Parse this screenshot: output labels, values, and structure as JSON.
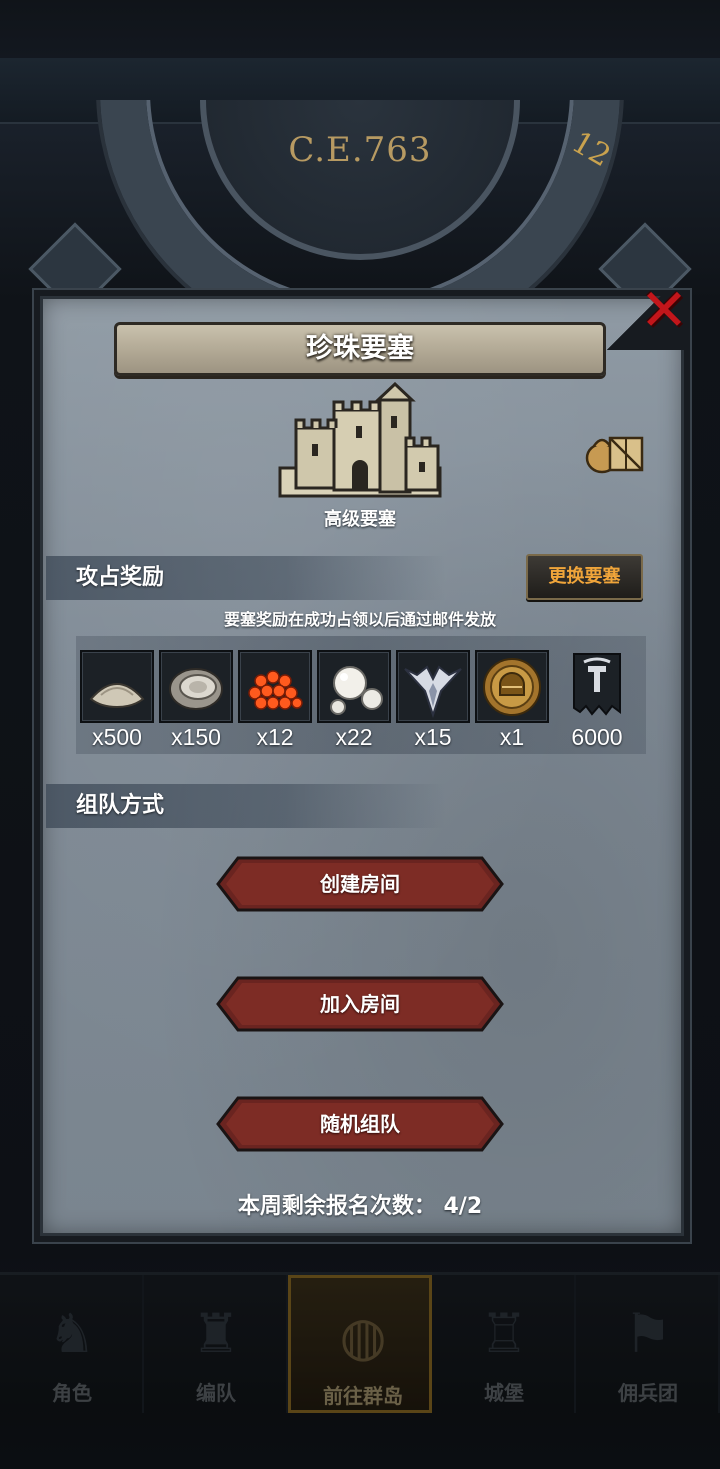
{
  "background": {
    "era_label": "C.E.763",
    "dial_hour": "12"
  },
  "bottom_nav": {
    "items": [
      {
        "label": "角色",
        "icon": "knight-helmet-icon"
      },
      {
        "label": "编队",
        "icon": "armored-knight-icon"
      },
      {
        "label": "前往群岛",
        "icon": "world-map-icon",
        "active": true
      },
      {
        "label": "城堡",
        "icon": "castle-icon"
      },
      {
        "label": "佣兵团",
        "icon": "mercenary-banner-icon"
      }
    ]
  },
  "modal": {
    "title": "珍珠要塞",
    "fortress": {
      "name": "高级要塞",
      "icon": "fortress-icon"
    },
    "supplies_icon": "supply-crate-icon",
    "close_icon": "close-x-icon",
    "capture_rewards": {
      "section_label": "攻占奖励",
      "change_button_label": "更换要塞",
      "notice": "要塞奖励在成功占领以后通过邮件发放",
      "items": [
        {
          "icon": "sand-pile-icon",
          "count": "x500"
        },
        {
          "icon": "oyster-shell-icon",
          "count": "x150"
        },
        {
          "icon": "fish-roe-icon",
          "count": "x12"
        },
        {
          "icon": "pearls-icon",
          "count": "x22"
        },
        {
          "icon": "winged-emblem-icon",
          "count": "x15"
        },
        {
          "icon": "gold-helmet-medal-icon",
          "count": "x1"
        },
        {
          "icon": "guild-banner-icon",
          "count": "6000"
        }
      ]
    },
    "team_mode": {
      "section_label": "组队方式",
      "buttons": [
        {
          "label": "创建房间"
        },
        {
          "label": "加入房间"
        },
        {
          "label": "随机组队"
        }
      ]
    },
    "remaining_label": "本周剩余报名次数：  4/2"
  },
  "colors": {
    "accent_gold": "#f0a53a",
    "button_red": "#7a2620",
    "close_red": "#c2161b",
    "panel_gray": "#8a959f"
  }
}
